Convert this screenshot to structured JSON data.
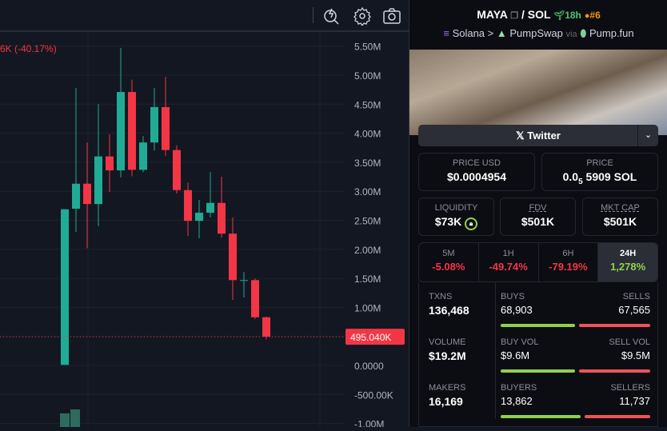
{
  "chart": {
    "change_text": "6K (-40.17%)",
    "current_price_label": "495.040K",
    "icons": [
      "quick-search-icon",
      "gear-icon",
      "camera-icon"
    ]
  },
  "chart_data": {
    "type": "candlestick",
    "y_ticks": [
      "5.50M",
      "5.00M",
      "4.50M",
      "4.00M",
      "3.50M",
      "3.00M",
      "2.50M",
      "2.00M",
      "1.50M",
      "1.00M",
      "500.000K",
      "0.0000",
      "-500.00K",
      "-1.00M"
    ],
    "y_tick_values": [
      5.5,
      5.0,
      4.5,
      4.0,
      3.5,
      3.0,
      2.5,
      2.0,
      1.5,
      1.0,
      0.5,
      0,
      -0.5,
      -1.0
    ],
    "ylim": [
      -1.05,
      5.85
    ],
    "unit": "M",
    "candles": [
      {
        "o": 0.01,
        "c": 2.69,
        "h": 2.69,
        "l": 0.01
      },
      {
        "o": 2.7,
        "c": 3.13,
        "h": 4.78,
        "l": 2.3
      },
      {
        "o": 3.13,
        "c": 2.78,
        "h": 3.84,
        "l": 2.02
      },
      {
        "o": 2.78,
        "c": 3.6,
        "h": 4.5,
        "l": 2.4
      },
      {
        "o": 3.6,
        "c": 3.36,
        "h": 3.98,
        "l": 2.99
      },
      {
        "o": 3.36,
        "c": 4.71,
        "h": 5.47,
        "l": 3.24
      },
      {
        "o": 4.71,
        "c": 3.37,
        "h": 4.92,
        "l": 3.26
      },
      {
        "o": 3.37,
        "c": 3.84,
        "h": 3.95,
        "l": 3.33
      },
      {
        "o": 3.84,
        "c": 4.45,
        "h": 4.78,
        "l": 3.7
      },
      {
        "o": 4.45,
        "c": 3.71,
        "h": 4.97,
        "l": 3.61
      },
      {
        "o": 3.71,
        "c": 3.02,
        "h": 3.79,
        "l": 2.96
      },
      {
        "o": 3.02,
        "c": 2.49,
        "h": 3.15,
        "l": 2.23
      },
      {
        "o": 2.49,
        "c": 2.63,
        "h": 2.85,
        "l": 2.19
      },
      {
        "o": 2.63,
        "c": 2.8,
        "h": 3.33,
        "l": 2.55
      },
      {
        "o": 2.8,
        "c": 2.27,
        "h": 3.25,
        "l": 2.2
      },
      {
        "o": 2.27,
        "c": 1.47,
        "h": 2.55,
        "l": 1.13
      },
      {
        "o": 1.46,
        "c": 1.47,
        "h": 1.61,
        "l": 1.17
      },
      {
        "o": 1.47,
        "c": 0.83,
        "h": 1.5,
        "l": 0.8
      },
      {
        "o": 0.83,
        "c": 0.495,
        "h": 0.84,
        "l": 0.45
      }
    ],
    "last_price": 0.495
  },
  "pair": {
    "base": "MAYA",
    "sep": "/",
    "quote": "SOL",
    "age": "18h",
    "rank": "#6",
    "chain": "Solana",
    "dex": "PumpSwap",
    "via": "via",
    "launchpad": "Pump.fun"
  },
  "twitter_label": "Twitter",
  "price_usd": {
    "label": "PRICE USD",
    "value": "$0.0004954"
  },
  "price_sol": {
    "label": "PRICE",
    "prefix": "0.0",
    "sub": "5",
    "value": "5909 SOL"
  },
  "liquidity": {
    "label": "LIQUIDITY",
    "value": "$73K"
  },
  "fdv": {
    "label": "FDV",
    "value": "$501K"
  },
  "mcap": {
    "label": "MKT CAP",
    "value": "$501K"
  },
  "tabs": [
    {
      "l": "5M",
      "v": "-5.08%"
    },
    {
      "l": "1H",
      "v": "-49.74%"
    },
    {
      "l": "6H",
      "v": "-79.19%"
    },
    {
      "l": "24H",
      "v": "1,278%"
    }
  ],
  "stats": {
    "txns": {
      "label": "TXNS",
      "value": "136,468",
      "a_label": "BUYS",
      "a": "68,903",
      "b_label": "SELLS",
      "b": "67,565",
      "ratio": 0.505
    },
    "volume": {
      "label": "VOLUME",
      "value": "$19.2M",
      "a_label": "BUY VOL",
      "a": "$9.6M",
      "b_label": "SELL VOL",
      "b": "$9.5M",
      "ratio": 0.503
    },
    "makers": {
      "label": "MAKERS",
      "value": "16,169",
      "a_label": "BUYERS",
      "a": "13,862",
      "b_label": "SELLERS",
      "b": "11,737",
      "ratio": 0.541
    }
  },
  "colors": {
    "up": "#22ab94",
    "down": "#f23645",
    "green_text": "#8fd14f"
  }
}
